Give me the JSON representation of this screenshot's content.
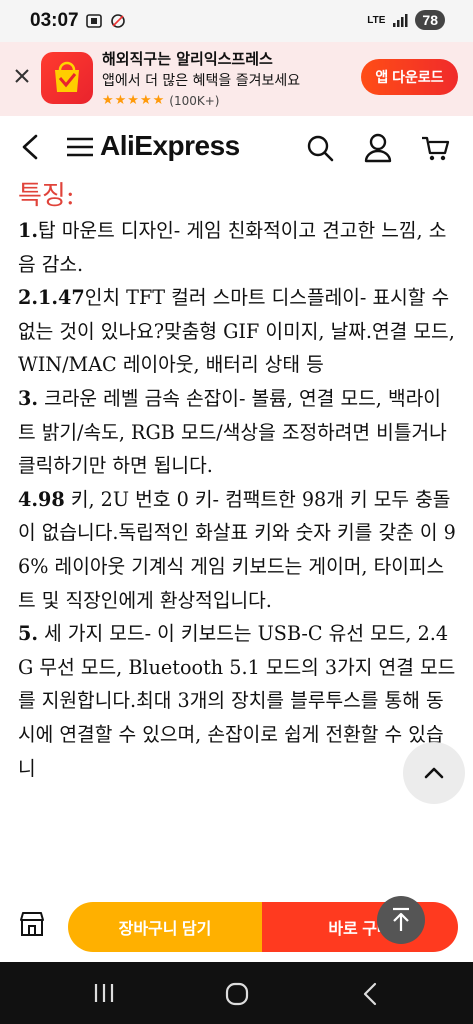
{
  "status_bar": {
    "time": "03:07",
    "network": "LTE",
    "battery": "78"
  },
  "app_banner": {
    "title": "해외직구는 알리익스프레스",
    "subtitle": "앱에서 더 많은 혜택을 즐겨보세요",
    "stars": "★★★★★",
    "rating_count": "(100K+)",
    "download_label": "앱 다운로드",
    "accent": "#ff4d16"
  },
  "header": {
    "logo": "AliExpress"
  },
  "content": {
    "section_title": "특징:",
    "features": [
      {
        "num": "1.",
        "text": "탑 마운트 디자인- 게임 친화적이고 견고한 느낌, 소음 감소."
      },
      {
        "num": "2.1.47",
        "text": "인치 TFT 컬러 스마트 디스플레이- 표시할 수 없는 것이 있나요?맞춤형 GIF 이미지, 날짜.연결 모드, WIN/MAC 레이아웃, 배터리 상태 등"
      },
      {
        "num": "3.",
        "text": " 크라운 레벨 금속 손잡이- 볼륨, 연결 모드, 백라이트 밝기/속도, RGB 모드/색상을 조정하려면 비틀거나 클릭하기만 하면 됩니다."
      },
      {
        "num": "4.98",
        "text": " 키, 2U 번호 0 키- 컴팩트한 98개 키 모두 충돌이 없습니다.독립적인 화살표 키와 숫자 키를 갖춘 이 96% 레이아웃 기계식 게임 키보드는 게이머, 타이피스트 및 직장인에게 환상적입니다."
      },
      {
        "num": "5.",
        "text": " 세 가지 모드- 이 키보드는 USB-C 유선 모드, 2.4G 무선 모드, Bluetooth 5.1 모드의 3가지 연결 모드를 지원합니다.최대 3개의 장치를 블루투스를 통해 동시에 연결할 수 있으며, 손잡이로 쉽게 전환할 수 있습니"
      }
    ]
  },
  "action_bar": {
    "add_to_cart": "장바구니 담기",
    "buy_now": "바로 구매"
  },
  "colors": {
    "title_red": "#e0433a",
    "cart_yellow": "#ffb000",
    "buy_red": "#ff3a1f"
  }
}
